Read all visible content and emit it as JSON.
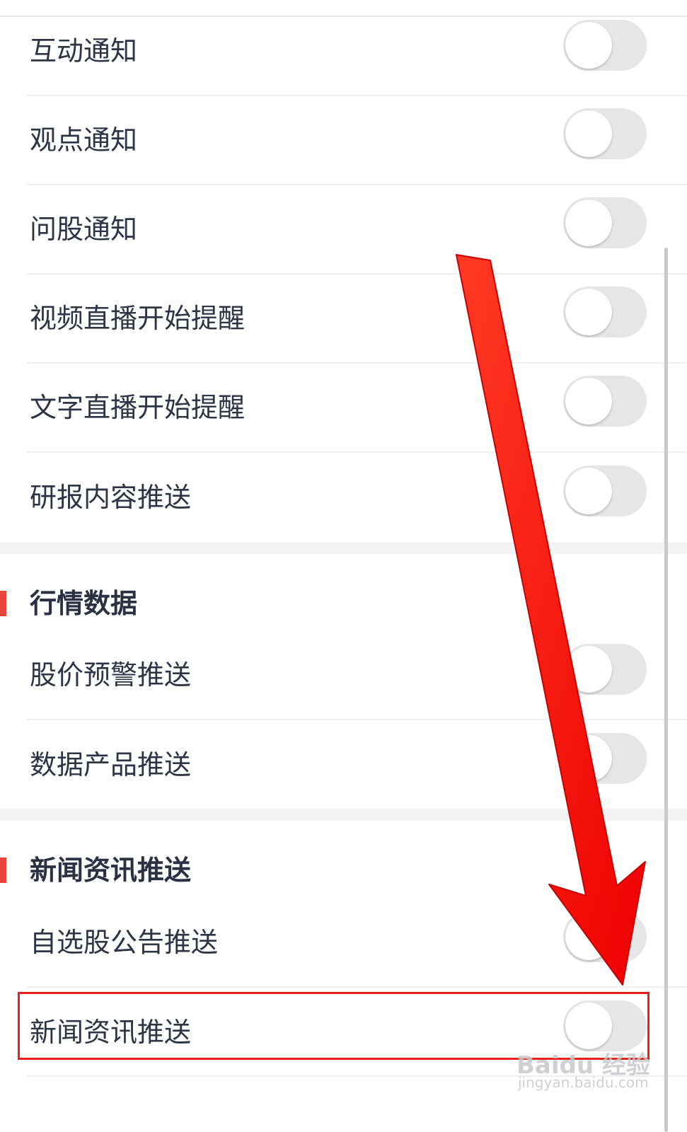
{
  "notifications": {
    "items": [
      {
        "label": "互动通知",
        "enabled": false
      },
      {
        "label": "观点通知",
        "enabled": false
      },
      {
        "label": "问股通知",
        "enabled": false
      },
      {
        "label": "视频直播开始提醒",
        "enabled": false
      },
      {
        "label": "文字直播开始提醒",
        "enabled": false
      },
      {
        "label": "研报内容推送",
        "enabled": false
      }
    ]
  },
  "market": {
    "title": "行情数据",
    "items": [
      {
        "label": "股价预警推送",
        "enabled": false
      },
      {
        "label": "数据产品推送",
        "enabled": false
      }
    ]
  },
  "news": {
    "title": "新闻资讯推送",
    "items": [
      {
        "label": "自选股公告推送",
        "enabled": false
      },
      {
        "label": "新闻资讯推送",
        "enabled": false
      }
    ]
  },
  "watermark": {
    "brand": "Baidu 经验",
    "url": "jingyan.baidu.com"
  },
  "colors": {
    "accent": "#e8453a",
    "annotation": "#ff1a0a",
    "toggle_off": "#e6e6e8"
  }
}
